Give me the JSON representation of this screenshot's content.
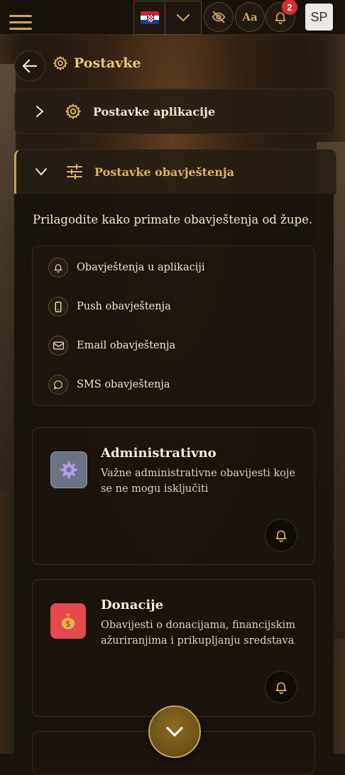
{
  "topbar": {
    "avatar_initials": "SP",
    "notification_count": "2",
    "font_button_label": "Aa",
    "language": "hr"
  },
  "header": {
    "title": "Postavke"
  },
  "accordions": [
    {
      "label": "Postavke aplikacije",
      "expanded": false
    },
    {
      "label": "Postavke obavještenja",
      "expanded": true
    }
  ],
  "notifications": {
    "intro": "Prilagodite kako primate obavještenja od župe.",
    "channels": [
      {
        "icon": "bell-icon",
        "label": "Obavještenja u aplikaciji"
      },
      {
        "icon": "phone-icon",
        "label": "Push obavještenja"
      },
      {
        "icon": "mail-icon",
        "label": "Email obavještenja"
      },
      {
        "icon": "chat-icon",
        "label": "SMS obavještenja"
      }
    ],
    "categories": [
      {
        "title": "Administrativno",
        "description": "Važne administrativne obavijesti koje se ne mogu isključiti",
        "tile_color": "#6b7385",
        "emoji": "⚙️"
      },
      {
        "title": "Donacije",
        "description": "Obavijesti o donacijama, financijskim ažuriranjima i prikupljanju sredstava",
        "tile_color": "#e5484d",
        "emoji": "💰"
      }
    ]
  },
  "colors": {
    "accent": "#c8a65c",
    "badge": "#d32f2f"
  }
}
